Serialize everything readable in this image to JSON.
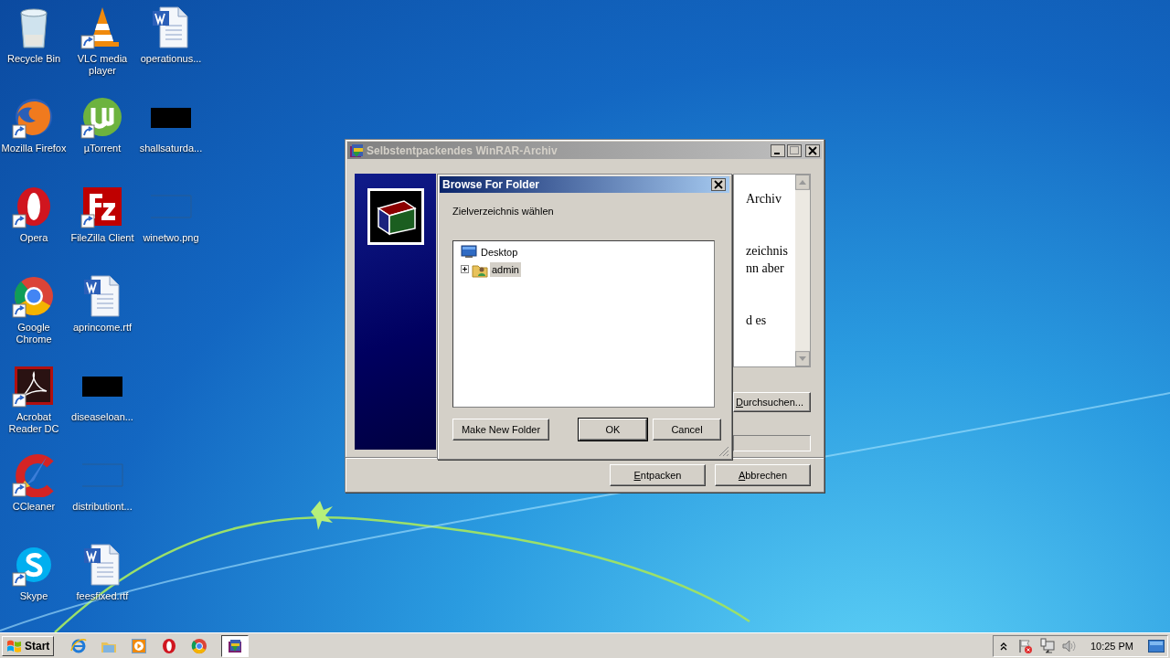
{
  "desktop_icons": [
    {
      "label": "Recycle Bin",
      "kind": "recycle",
      "shortcut": false
    },
    {
      "label": "Mozilla Firefox",
      "kind": "firefox",
      "shortcut": true
    },
    {
      "label": "Opera",
      "kind": "opera",
      "shortcut": true
    },
    {
      "label": "Google Chrome",
      "kind": "chrome",
      "shortcut": true
    },
    {
      "label": "Acrobat Reader DC",
      "kind": "acrobat",
      "shortcut": true
    },
    {
      "label": "CCleaner",
      "kind": "ccleaner",
      "shortcut": true
    },
    {
      "label": "Skype",
      "kind": "skype",
      "shortcut": true
    },
    {
      "label": "VLC media player",
      "kind": "vlc",
      "shortcut": true
    },
    {
      "label": "µTorrent",
      "kind": "utorrent",
      "shortcut": true
    },
    {
      "label": "FileZilla Client",
      "kind": "filezilla",
      "shortcut": true
    },
    {
      "label": "aprincome.rtf",
      "kind": "word",
      "shortcut": false
    },
    {
      "label": "diseaseloan...",
      "kind": "black",
      "shortcut": false
    },
    {
      "label": "distributiont...",
      "kind": "blank",
      "shortcut": false
    },
    {
      "label": "feesfixed.rtf",
      "kind": "word",
      "shortcut": false
    },
    {
      "label": "operationus...",
      "kind": "word",
      "shortcut": false
    },
    {
      "label": "shallsaturda...",
      "kind": "black",
      "shortcut": false
    },
    {
      "label": "winetwo.png",
      "kind": "blank",
      "shortcut": false
    }
  ],
  "winrar_window": {
    "title": "Selbstentpackendes WinRAR-Archiv",
    "active": false,
    "text_paragraphs": [
      [
        "Archiv"
      ],
      [
        "zeichnis",
        "nn aber"
      ],
      [
        "d es"
      ]
    ],
    "browse_button": {
      "label": "Durchsuchen...",
      "underline_first": true
    },
    "buttons": [
      {
        "label": "Entpacken",
        "underline_first": true
      },
      {
        "label": "Abbrechen",
        "underline_first": true
      }
    ]
  },
  "browse_dialog": {
    "title": "Browse For Folder",
    "active": true,
    "prompt": "Zielverzeichnis wählen",
    "tree": [
      {
        "label": "Desktop",
        "kind": "desktop",
        "selected": false,
        "children": [
          {
            "label": "admin",
            "kind": "user",
            "selected": true,
            "expanded": false
          }
        ]
      }
    ],
    "buttons": [
      {
        "label": "Make New Folder",
        "default": false
      },
      {
        "label": "OK",
        "default": true
      },
      {
        "label": "Cancel",
        "default": false
      }
    ]
  },
  "taskbar": {
    "start_label": "Start",
    "items": [
      {
        "kind": "ie",
        "active": false
      },
      {
        "kind": "explorer",
        "active": false
      },
      {
        "kind": "media",
        "active": false
      },
      {
        "kind": "opera",
        "active": false
      },
      {
        "kind": "chrome",
        "active": false
      },
      {
        "kind": "winrar",
        "active": true
      }
    ],
    "clock": "10:25 PM"
  }
}
